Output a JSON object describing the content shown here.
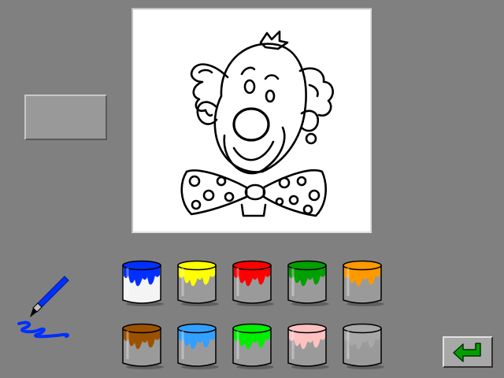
{
  "canvas": {
    "picture": "clown"
  },
  "preview": {
    "color": "#999999"
  },
  "tools": {
    "brush_icon": "paintbrush-icon",
    "brush_color": "#0030ff"
  },
  "palette": [
    {
      "name": "blue",
      "color": "#0030ff"
    },
    {
      "name": "yellow",
      "color": "#ffff00"
    },
    {
      "name": "red",
      "color": "#ff0000"
    },
    {
      "name": "dark-green",
      "color": "#00a000"
    },
    {
      "name": "orange",
      "color": "#ff9900"
    },
    {
      "name": "brown",
      "color": "#9b5200"
    },
    {
      "name": "light-blue",
      "color": "#33a0ff"
    },
    {
      "name": "green",
      "color": "#00ee00"
    },
    {
      "name": "pink",
      "color": "#ffc0c0"
    },
    {
      "name": "gray",
      "color": "#a8a8a8"
    }
  ],
  "nav": {
    "back_icon": "return-arrow-icon",
    "accent": "#00a000"
  }
}
